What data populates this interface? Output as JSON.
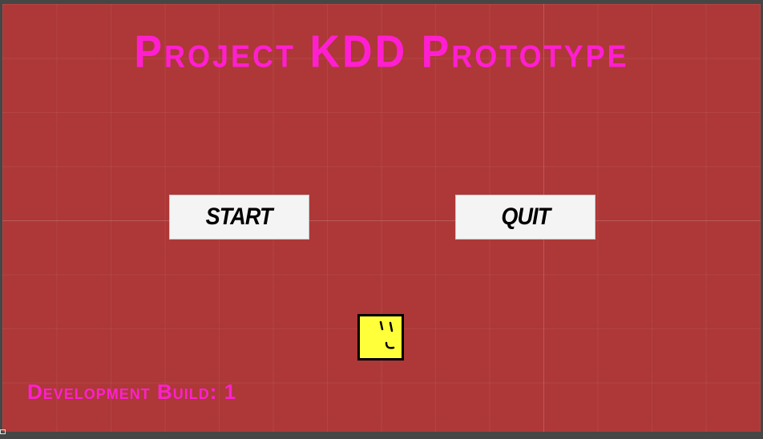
{
  "title": "Project KDD Prototype",
  "buttons": {
    "start_label": "START",
    "quit_label": "QUIT"
  },
  "character": {
    "icon": "smiley-face-icon",
    "color": "#ffff3a"
  },
  "build_label": "Development Build: 1",
  "colors": {
    "background": "#ad3837",
    "title": "#ff1fd1",
    "button_bg": "#f4f4f4"
  }
}
